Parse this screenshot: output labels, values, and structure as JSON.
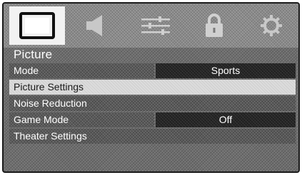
{
  "tabs": [
    {
      "icon": "picture-icon",
      "active": true
    },
    {
      "icon": "speaker-icon",
      "active": false
    },
    {
      "icon": "sliders-icon",
      "active": false
    },
    {
      "icon": "lock-icon",
      "active": false
    },
    {
      "icon": "gear-icon",
      "active": false
    }
  ],
  "section": {
    "title": "Picture"
  },
  "menu": {
    "mode": {
      "label": "Mode",
      "value": "Sports"
    },
    "picture_settings": {
      "label": "Picture Settings",
      "selected": true
    },
    "noise_reduction": {
      "label": "Noise Reduction"
    },
    "game_mode": {
      "label": "Game Mode",
      "value": "Off"
    },
    "theater_settings": {
      "label": "Theater Settings"
    }
  },
  "colors": {
    "background": "#6e6e6e",
    "selected_row": "#dcdcdc",
    "value_cell": "#262626",
    "text": "#ffffff"
  }
}
